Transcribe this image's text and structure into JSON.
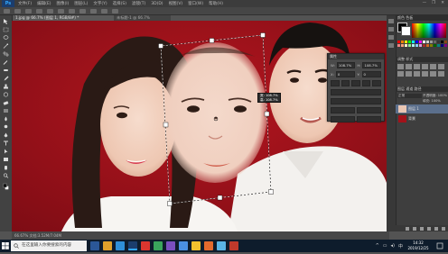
{
  "app": {
    "logo_text": "Ps",
    "menu": [
      "文件(F)",
      "编辑(E)",
      "图像(I)",
      "图层(L)",
      "文字(Y)",
      "选择(S)",
      "滤镜(T)",
      "3D(D)",
      "视图(V)",
      "窗口(W)",
      "帮助(H)"
    ],
    "window_controls": [
      "—",
      "❐",
      "✕"
    ]
  },
  "document": {
    "active_tab": "1.jpg @ 66.7% (图层 1, RGB/8#) *",
    "second_tab": "未标题-1 @ 66.7%"
  },
  "transform_readout": "宽: 108.7%\n高: 108.7%",
  "properties_panel": {
    "title": "属性",
    "fields": [
      {
        "label": "W:",
        "value": "108.7%"
      },
      {
        "label": "H:",
        "value": "108.7%"
      },
      {
        "label": "X:",
        "value": "0"
      },
      {
        "label": "Y:",
        "value": "0"
      }
    ]
  },
  "panels": {
    "color_tab": "颜色  色板",
    "adjust_tab": "调整  样式",
    "layers_tab": "图层  通道  路径",
    "layers": [
      {
        "name": "图层 1",
        "selected": true
      },
      {
        "name": "背景",
        "selected": false
      }
    ],
    "opacity_label": "不透明度: 100%",
    "fill_label": "填充: 100%"
  },
  "status_bar": {
    "text": "66.67%   文档:3.52M/7.04M"
  },
  "taskbar": {
    "search_placeholder": "在这里输入你要搜索的内容",
    "clock_time": "14:32",
    "clock_date": "2019/12/25",
    "tray_lang": "中"
  },
  "colors": {
    "canvas_bg": "#a3121a",
    "ps_chrome": "#535353",
    "taskbar": "#0e1c2c",
    "accent_blue": "#31a8ff"
  }
}
